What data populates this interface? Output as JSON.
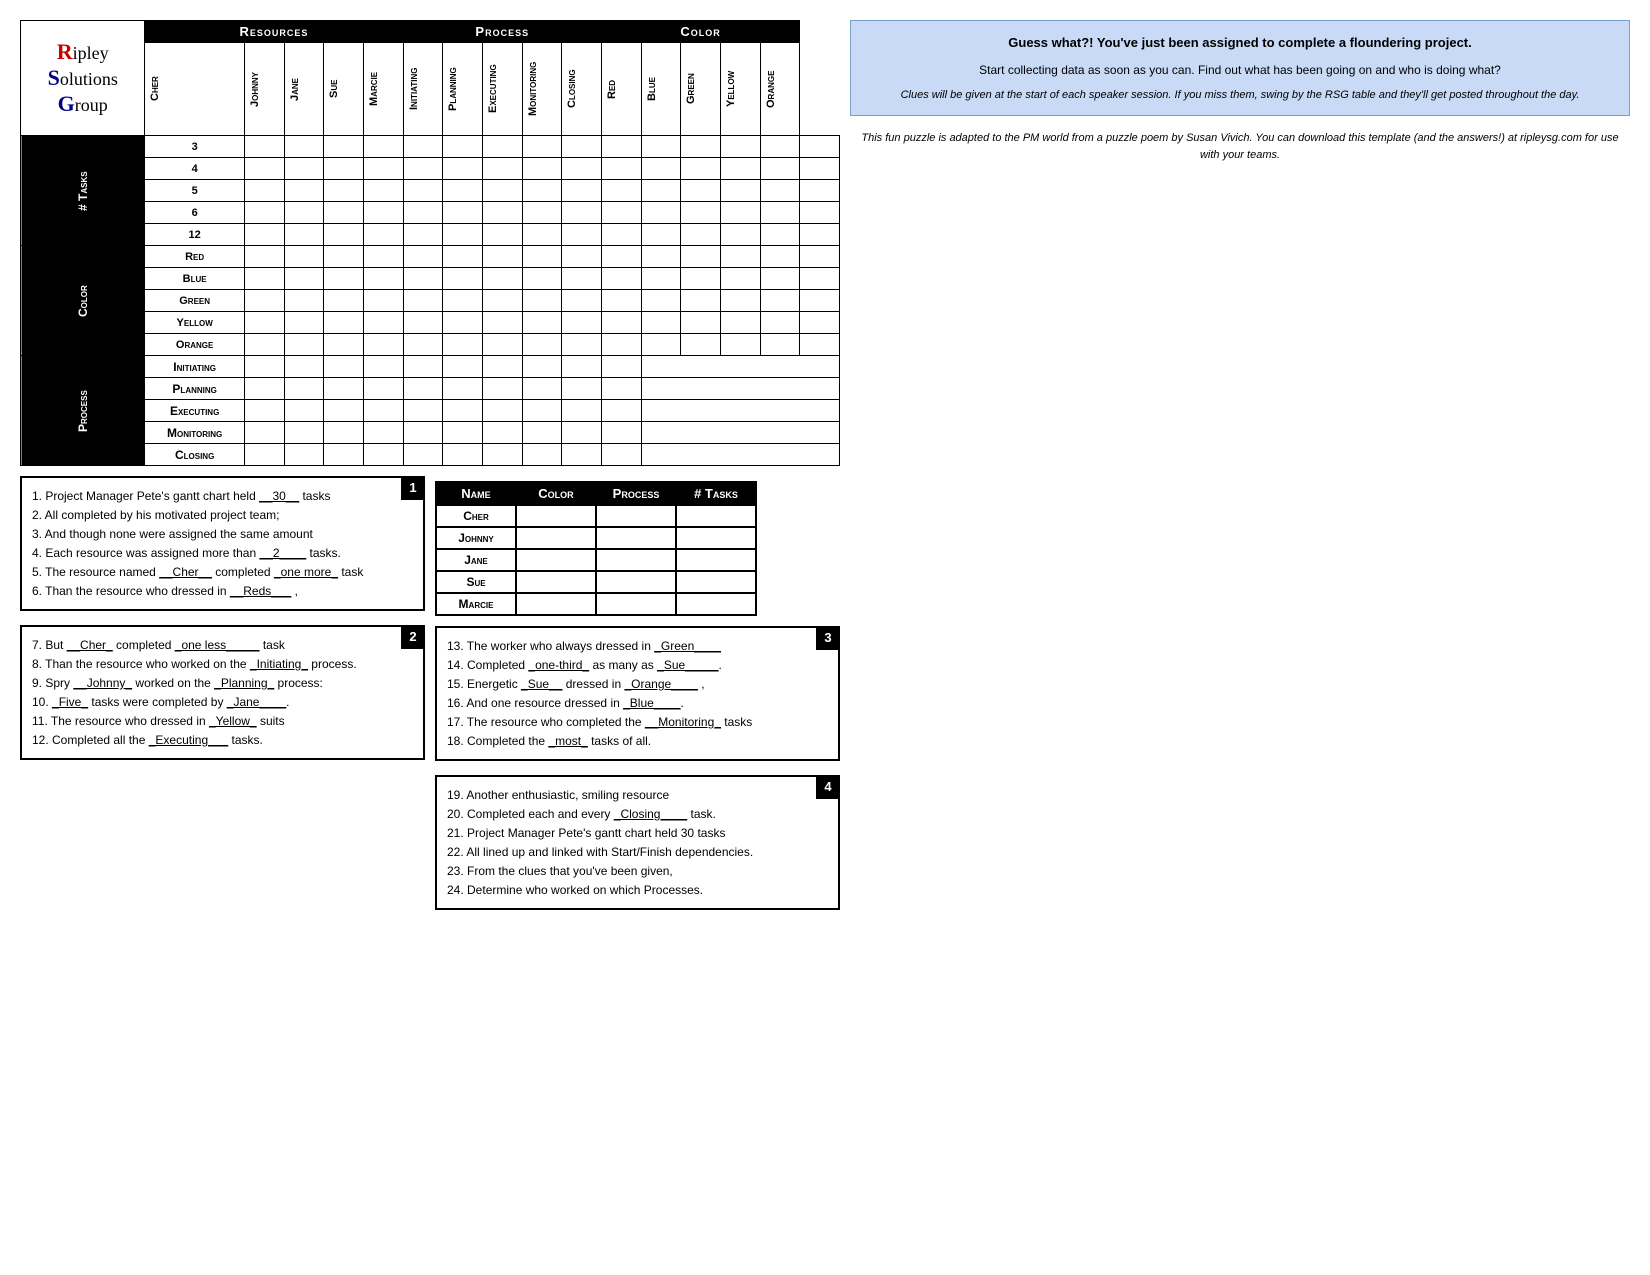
{
  "logo": {
    "r": "R",
    "ipley": "ipley",
    "s": "S",
    "olutions": "olutions",
    "g": "G",
    "roup": "roup"
  },
  "headers": {
    "resources": "Resources",
    "process": "Process",
    "color": "Color"
  },
  "resource_columns": [
    "Cher",
    "Johnny",
    "Jane",
    "Sue",
    "Marcie"
  ],
  "process_columns": [
    "Initiating",
    "Planning",
    "Executing",
    "Monitoring",
    "Closing"
  ],
  "color_columns": [
    "Red",
    "Blue",
    "Green",
    "Yellow",
    "Orange"
  ],
  "row_groups": {
    "tasks": {
      "label": "# Tasks",
      "rows": [
        "3",
        "4",
        "5",
        "6",
        "12"
      ]
    },
    "color": {
      "label": "Color",
      "rows": [
        "Red",
        "Blue",
        "Green",
        "Yellow",
        "Orange"
      ]
    },
    "process": {
      "label": "Process",
      "rows": [
        "Initiating",
        "Planning",
        "Executing",
        "Monitoring",
        "Closing"
      ]
    }
  },
  "answer_table": {
    "headers": [
      "Name",
      "Color",
      "Process",
      "# Tasks"
    ],
    "rows": [
      {
        "name": "Cher",
        "color": "",
        "process": "",
        "tasks": ""
      },
      {
        "name": "Johnny",
        "color": "",
        "process": "",
        "tasks": ""
      },
      {
        "name": "Jane",
        "color": "",
        "process": "",
        "tasks": ""
      },
      {
        "name": "Sue",
        "color": "",
        "process": "",
        "tasks": ""
      },
      {
        "name": "Marcie",
        "color": "",
        "process": "",
        "tasks": ""
      }
    ]
  },
  "info_box": {
    "headline": "Guess what?! You've just been assigned to complete a floundering project.",
    "body1": "Start collecting data as soon as you can.  Find out what has been going on and who is doing what?",
    "italic_note": "Clues will be given at the start of each speaker session.  If you miss them, swing by the RSG table and they'll get posted throughout the day."
  },
  "footer_note": "This fun puzzle is adapted to the PM world from a puzzle poem by Susan Vivich.  You can download this template (and the answers!) at ripleysg.com for use with your teams.",
  "clues": {
    "box1": [
      "1.  Project Manager Pete’s gantt chart held __30__ tasks",
      "2.  All completed by his motivated project team;",
      "3.  And though none were assigned the same amount",
      "4.  Each resource was assigned more than __2____ tasks.",
      "5.  The resource named __Cher__ completed _one more_ task",
      "6.  Than the resource who dressed in __Reds___ ,"
    ],
    "box2": [
      "7.  But __Cher_ completed _one less_____ task",
      "8.  Than the resource who worked on the _Initiating_ process.",
      "9.  Spry __Johnny_ worked on the _Planning_ process:",
      "10. _Five_ tasks were completed by _Jane____.",
      "11. The resource who dressed in _Yellow_ suits",
      "12. Completed all the _Executing___ tasks."
    ],
    "box3": [
      "13. The worker who always dressed in _Green____",
      "14. Completed _one-third_ as many as _Sue_____.",
      "15. Energetic _Sue__ dressed in _Orange____ ,",
      "16. And one resource dressed in _Blue____.",
      "17. The resource who completed the __Monitoring_ tasks",
      "18. Completed the _most_ tasks of all."
    ],
    "box4": [
      "19. Another enthusiastic, smiling resource",
      "20. Completed each and every _Closing____ task.",
      "21. Project Manager Pete’s gantt chart held 30 tasks",
      "22. All lined up and linked with Start/Finish dependencies.",
      "23. From the clues that you’ve been given,",
      "24. Determine who worked on which Processes."
    ]
  }
}
